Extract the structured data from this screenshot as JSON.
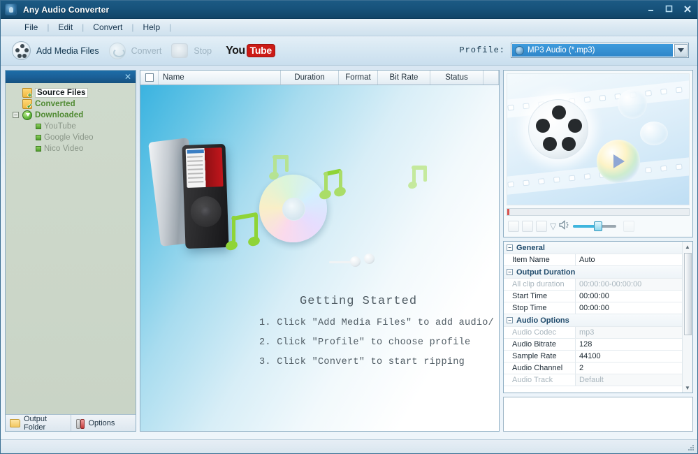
{
  "window": {
    "title": "Any Audio Converter",
    "icon": "app-icon",
    "minimize": "–",
    "maximize": "☐",
    "close": "✕"
  },
  "menubar": {
    "items": [
      "File",
      "Edit",
      "Convert",
      "Help"
    ],
    "separator": "|"
  },
  "toolbar": {
    "add_media_label": "Add Media Files",
    "convert_label": "Convert",
    "stop_label": "Stop",
    "youtube_you": "You",
    "youtube_tube": "Tube",
    "profile_label": "Profile:",
    "profile_value": "MP3 Audio (*.mp3)",
    "combo_arrow": "▼"
  },
  "sidebar": {
    "close_icon": "✕",
    "items": [
      {
        "label": "Source Files",
        "icon": "folder-plus-icon",
        "selected": true
      },
      {
        "label": "Converted",
        "icon": "folder-check-icon",
        "selected": false
      },
      {
        "label": "Downloaded",
        "icon": "download-icon",
        "expander": "–",
        "selected": false
      },
      {
        "label": "YouTube",
        "icon": "bullet-icon",
        "child": true
      },
      {
        "label": "Google Video",
        "icon": "bullet-icon",
        "child": true
      },
      {
        "label": "Nico Video",
        "icon": "bullet-icon",
        "child": true
      }
    ],
    "footer": {
      "output_folder": "Output Folder",
      "options": "Options"
    }
  },
  "filelist": {
    "columns": [
      "Name",
      "Duration",
      "Format",
      "Bit Rate",
      "Status"
    ],
    "rows": [],
    "getting_started": {
      "title": "Getting Started",
      "steps": [
        "1. Click \"Add Media Files\" to add audio/",
        "2. Click \"Profile\" to choose profile",
        "3. Click \"Convert\" to start ripping"
      ]
    }
  },
  "preview": {
    "controls": {
      "prev": "◀◀",
      "play": "▶",
      "next": "▶▶",
      "expand": "▽",
      "speaker": "speaker-icon"
    }
  },
  "properties": {
    "groups": [
      {
        "name": "General",
        "expander": "–",
        "rows": [
          {
            "name": "Item Name",
            "value": "Auto",
            "dim": false
          }
        ]
      },
      {
        "name": "Output Duration",
        "expander": "–",
        "rows": [
          {
            "name": "All clip duration",
            "value": "00:00:00-00:00:00",
            "dim": true
          },
          {
            "name": "Start Time",
            "value": "00:00:00",
            "dim": false
          },
          {
            "name": "Stop Time",
            "value": "00:00:00",
            "dim": false
          }
        ]
      },
      {
        "name": "Audio Options",
        "expander": "–",
        "rows": [
          {
            "name": "Audio Codec",
            "value": "mp3",
            "dim": true
          },
          {
            "name": "Audio Bitrate",
            "value": "128",
            "dim": false
          },
          {
            "name": "Sample Rate",
            "value": "44100",
            "dim": false
          },
          {
            "name": "Audio Channel",
            "value": "2",
            "dim": false
          },
          {
            "name": "Audio Track",
            "value": "Default",
            "dim": true
          }
        ]
      }
    ],
    "scroll_up": "▲",
    "scroll_down": "▼"
  },
  "colors": {
    "titlebar": "#17527b",
    "accent_blue": "#2f86c9",
    "youtube_red": "#cc1b16",
    "tree_green": "#4f8a32"
  }
}
